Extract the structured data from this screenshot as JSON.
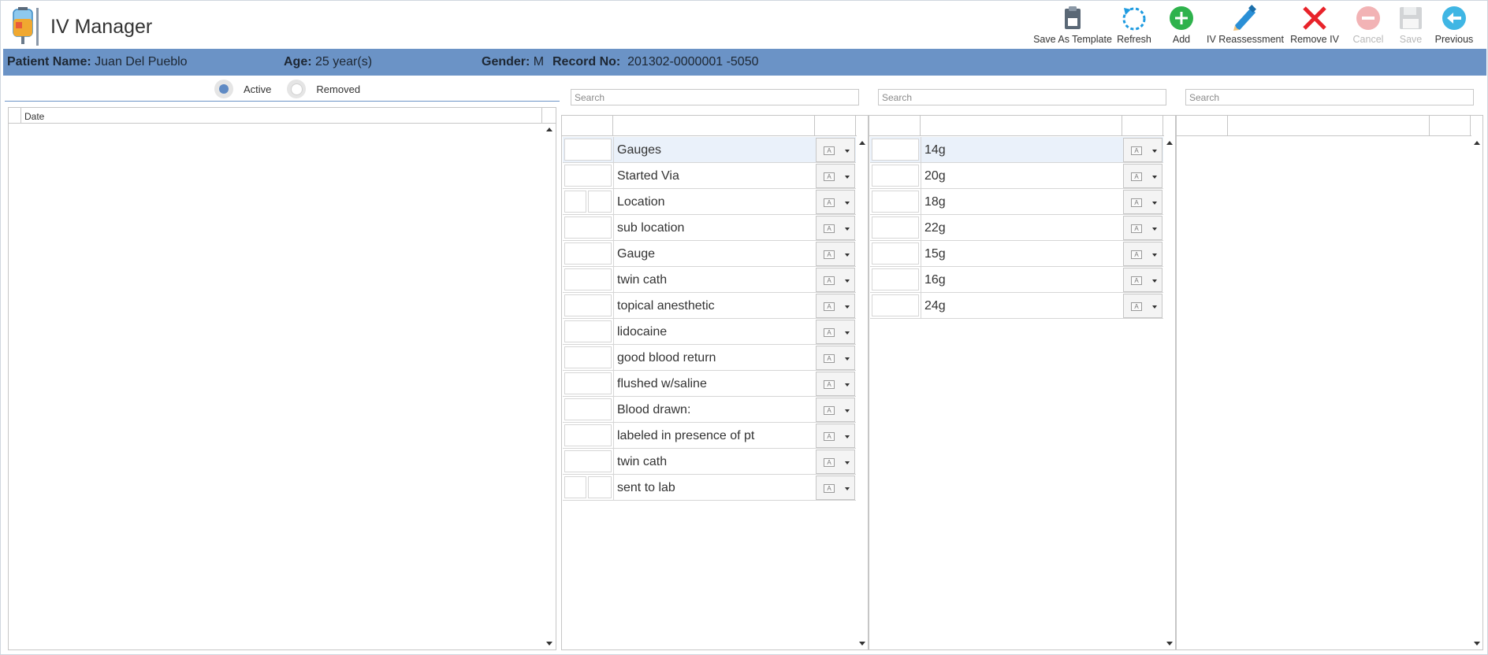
{
  "app": {
    "title": "IV Manager"
  },
  "toolbar": [
    {
      "label": "Save As Template",
      "icon": "clipboard-icon",
      "enabled": true
    },
    {
      "label": "Refresh",
      "icon": "refresh-icon",
      "enabled": true
    },
    {
      "label": "Add",
      "icon": "add-icon",
      "enabled": true
    },
    {
      "label": "IV Reassessment",
      "icon": "pencil-icon",
      "enabled": true
    },
    {
      "label": "Remove IV",
      "icon": "remove-x-icon",
      "enabled": true
    },
    {
      "label": "Cancel",
      "icon": "cancel-icon",
      "enabled": false
    },
    {
      "label": "Save",
      "icon": "floppy-disk-icon",
      "enabled": false
    },
    {
      "label": "Previous",
      "icon": "back-arrow-icon",
      "enabled": true
    }
  ],
  "patient": {
    "name_label": "Patient Name:",
    "name": "Juan Del Pueblo",
    "age_label": "Age:",
    "age": "25 year(s)",
    "gender_label": "Gender:",
    "gender": "M",
    "record_label": "Record No:",
    "record": "201302-0000001 -5050"
  },
  "filter": {
    "active_label": "Active",
    "removed_label": "Removed",
    "selected": "active"
  },
  "left_grid": {
    "date_header": "Date"
  },
  "search": {
    "placeholder": "Search"
  },
  "panel1": {
    "items": [
      "Gauges",
      "Started Via",
      "Location",
      "sub location",
      "Gauge",
      "twin cath",
      "topical anesthetic",
      "lidocaine",
      "good blood return",
      "flushed w/saline",
      "Blood drawn:",
      "labeled in presence of pt",
      "twin cath",
      "sent to lab"
    ]
  },
  "panel2": {
    "items": [
      "14g",
      "20g",
      "18g",
      "22g",
      "15g",
      "16g",
      "24g"
    ]
  },
  "colors": {
    "banner": "#6b93c6",
    "accent": "#5f8ac4",
    "add_green": "#2eb24c",
    "remove_red": "#e8232a",
    "refresh_blue": "#1e9be0"
  }
}
